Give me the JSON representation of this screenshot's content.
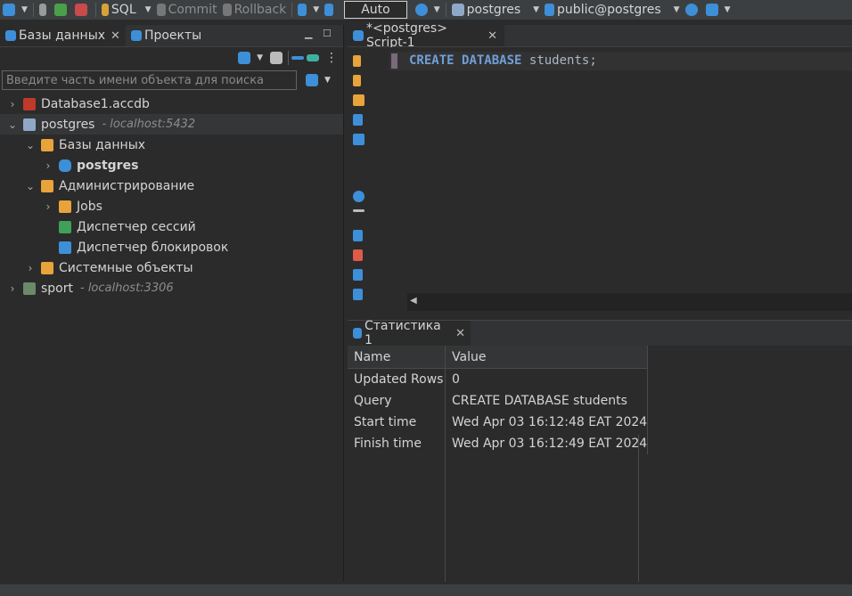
{
  "toolbar": {
    "sql_label": "SQL",
    "commit_label": "Commit",
    "rollback_label": "Rollback",
    "transaction_mode": "Auto",
    "datasource": "postgres",
    "schema": "public@postgres"
  },
  "navigator": {
    "tabs": [
      {
        "label": "Базы данных"
      },
      {
        "label": "Проекты"
      }
    ],
    "search_placeholder": "Введите часть имени объекта для поиска",
    "tree": {
      "database1": {
        "label": "Database1.accdb"
      },
      "postgres": {
        "label": "postgres",
        "host": "- localhost:5432"
      },
      "databases_folder": {
        "label": "Базы данных"
      },
      "postgres_db": {
        "label": "postgres"
      },
      "admin_folder": {
        "label": "Администрирование"
      },
      "jobs": {
        "label": "Jobs"
      },
      "session_manager": {
        "label": "Диспетчер сессий"
      },
      "lock_manager": {
        "label": "Диспетчер блокировок"
      },
      "system_objects": {
        "label": "Системные объекты"
      },
      "sport": {
        "label": "sport",
        "host": "- localhost:3306"
      }
    }
  },
  "editor": {
    "tab_label": "*<postgres> Script-1",
    "code": {
      "kw1": "CREATE",
      "kw2": "DATABASE",
      "ident": "students;"
    }
  },
  "results": {
    "tab_label": "Статистика 1",
    "columns": [
      "Name",
      "Value"
    ],
    "rows": [
      {
        "name": "Updated Rows",
        "value": "0"
      },
      {
        "name": "Query",
        "value": "CREATE DATABASE students"
      },
      {
        "name": "Start time",
        "value": "Wed Apr 03 16:12:48 EAT 2024"
      },
      {
        "name": "Finish time",
        "value": "Wed Apr 03 16:12:49 EAT 2024"
      }
    ]
  },
  "colors": {
    "background": "#2b2b2b",
    "keyword": "#6f9fd8",
    "accent_orange": "#e8a33a",
    "accent_blue": "#3d8fd8"
  }
}
